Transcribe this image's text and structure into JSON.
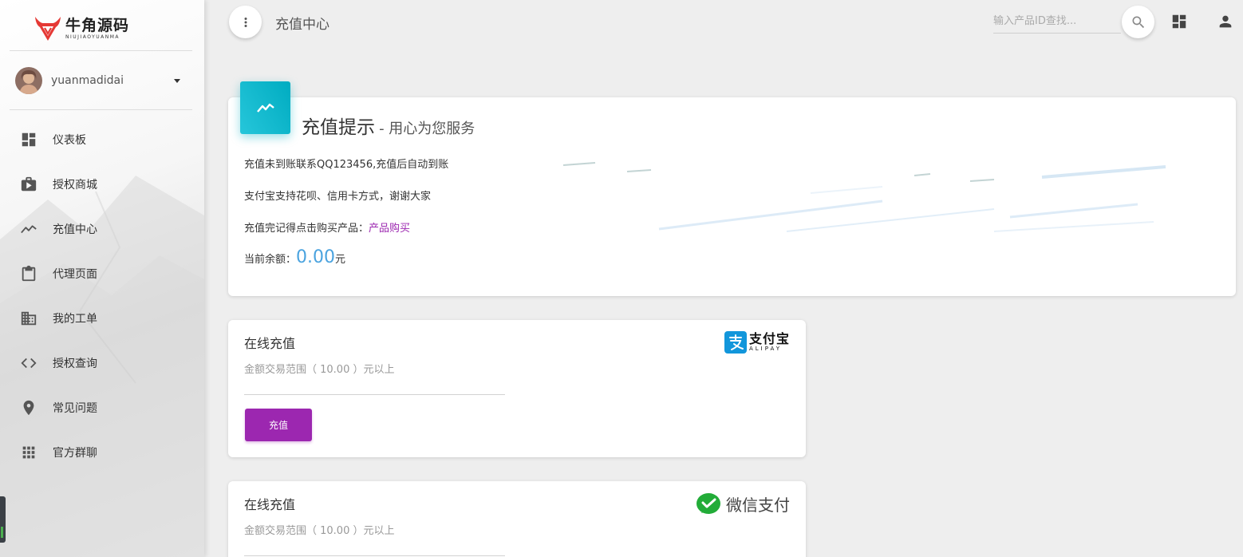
{
  "brand": {
    "name_cn": "牛角源码",
    "name_en": "NIUJIAOYUANMA",
    "color": "#e53935"
  },
  "user": {
    "name": "yuanmadidai"
  },
  "sidebar": {
    "items": [
      {
        "label": "仪表板",
        "icon": "dashboard-icon"
      },
      {
        "label": "授权商城",
        "icon": "shop-bag-icon"
      },
      {
        "label": "充值中心",
        "icon": "trending-icon"
      },
      {
        "label": "代理页面",
        "icon": "clipboard-icon"
      },
      {
        "label": "我的工单",
        "icon": "building-icon"
      },
      {
        "label": "授权查询",
        "icon": "code-icon"
      },
      {
        "label": "常见问题",
        "icon": "location-pin-icon"
      },
      {
        "label": "官方群聊",
        "icon": "apps-grid-icon"
      }
    ]
  },
  "header": {
    "title": "充值中心",
    "search_placeholder": "输入产品ID查找..."
  },
  "tip_card": {
    "title": "充值提示",
    "subtitle": "- 用心为您服务",
    "line1": "充值未到账联系QQ123456,充值后自动到账",
    "line2": "支付宝支持花呗、信用卡方式，谢谢大家",
    "line3_prefix": "充值完记得点击购买产品：",
    "line3_link": "产品购买",
    "balance_label": "当前余额：",
    "balance_value": "0.00",
    "balance_unit": "元",
    "icon_color": "#00acc1"
  },
  "alipay_card": {
    "title": "在线充值",
    "range": "金额交易范围（ 10.00 ）元以上",
    "button": "充值",
    "logo_cn": "支付宝",
    "logo_en": "ALIPAY",
    "logo_color": "#1296db",
    "button_color": "#9c27b0"
  },
  "wechat_card": {
    "title": "在线充值",
    "range": "金额交易范围（ 10.00 ）元以上",
    "logo_text": "微信支付",
    "logo_color": "#22ac38"
  }
}
